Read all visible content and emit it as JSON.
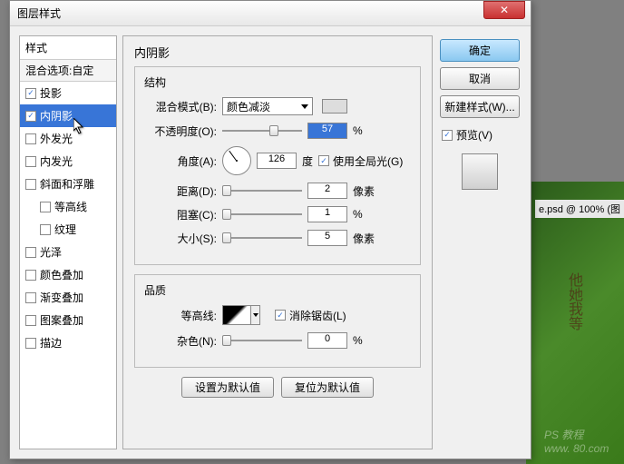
{
  "background": {
    "tab_text": "e.psd @ 100% (图",
    "vertical_text": "他她我等",
    "watermark1": "PS 教程",
    "watermark2": "www.    80.com"
  },
  "dialog": {
    "title": "图层样式",
    "close_x": "✕"
  },
  "styles": {
    "header": "样式",
    "blend_options": "混合选项:自定",
    "items": [
      {
        "label": "投影",
        "checked": true,
        "selected": false
      },
      {
        "label": "内阴影",
        "checked": true,
        "selected": true
      },
      {
        "label": "外发光",
        "checked": false,
        "selected": false
      },
      {
        "label": "内发光",
        "checked": false,
        "selected": false
      },
      {
        "label": "斜面和浮雕",
        "checked": false,
        "selected": false
      },
      {
        "label": "等高线",
        "checked": false,
        "selected": false,
        "indent": true
      },
      {
        "label": "纹理",
        "checked": false,
        "selected": false,
        "indent": true
      },
      {
        "label": "光泽",
        "checked": false,
        "selected": false
      },
      {
        "label": "颜色叠加",
        "checked": false,
        "selected": false
      },
      {
        "label": "渐变叠加",
        "checked": false,
        "selected": false
      },
      {
        "label": "图案叠加",
        "checked": false,
        "selected": false
      },
      {
        "label": "描边",
        "checked": false,
        "selected": false
      }
    ]
  },
  "settings": {
    "panel_title": "内阴影",
    "structure": {
      "title": "结构",
      "blend_mode_label": "混合模式(B):",
      "blend_mode_value": "颜色减淡",
      "opacity_label": "不透明度(O):",
      "opacity_value": "57",
      "opacity_unit": "%",
      "angle_label": "角度(A):",
      "angle_value": "126",
      "angle_unit": "度",
      "global_light_label": "使用全局光(G)",
      "distance_label": "距离(D):",
      "distance_value": "2",
      "distance_unit": "像素",
      "choke_label": "阻塞(C):",
      "choke_value": "1",
      "choke_unit": "%",
      "size_label": "大小(S):",
      "size_value": "5",
      "size_unit": "像素"
    },
    "quality": {
      "title": "品质",
      "contour_label": "等高线:",
      "antialias_label": "消除锯齿(L)",
      "noise_label": "杂色(N):",
      "noise_value": "0",
      "noise_unit": "%"
    },
    "set_default": "设置为默认值",
    "reset_default": "复位为默认值"
  },
  "buttons": {
    "ok": "确定",
    "cancel": "取消",
    "new_style": "新建样式(W)...",
    "preview": "预览(V)"
  }
}
